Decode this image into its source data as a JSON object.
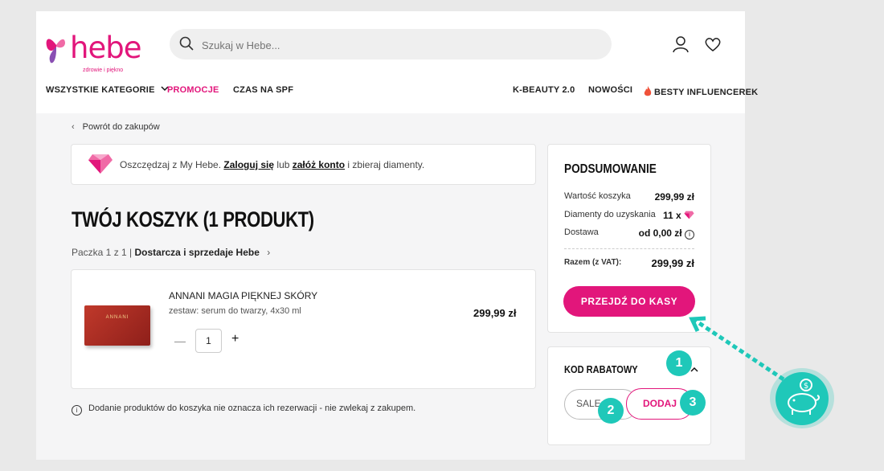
{
  "header": {
    "logo_text": "hebe",
    "logo_tagline": "zdrowie i piękno",
    "search_placeholder": "Szukaj w Hebe...",
    "nav": [
      {
        "label": "WSZYSTKIE KATEGORIE"
      },
      {
        "label": "PROMOCJE"
      },
      {
        "label": "CZAS NA SPF"
      },
      {
        "label": "K-BEAUTY 2.0"
      },
      {
        "label": "NOWOŚCI"
      },
      {
        "label": "BESTY INFLUENCEREK"
      }
    ]
  },
  "back_link": "Powrót do zakupów",
  "promo": {
    "text_before": "Oszczędzaj z My Hebe. ",
    "login": "Zaloguj się",
    "middle": " lub ",
    "register": "załóż konto",
    "text_after": " i zbieraj diamenty."
  },
  "cart": {
    "title": "TWÓJ KOSZYK (1 PRODUKT)",
    "parcel_label": "Paczka 1 z 1",
    "parcel_seller": "Dostarcza i sprzedaje Hebe",
    "product": {
      "name": "ANNANI MAGIA PIĘKNEJ SKÓRY",
      "image_text": "ANNANI",
      "description": "zestaw: serum do twarzy, 4x30 ml",
      "price": "299,99 zł",
      "quantity": "1"
    },
    "note": "Dodanie produktów do koszyka nie oznacza ich rezerwacji - nie zwlekaj z zakupem."
  },
  "summary": {
    "title": "PODSUMOWANIE",
    "rows": [
      {
        "label": "Wartość koszyka",
        "value": "299,99 zł"
      },
      {
        "label": "Diamenty do uzyskania",
        "value": "11 x"
      },
      {
        "label": "Dostawa",
        "value": "od 0,00 zł"
      }
    ],
    "total_label": "Razem (z VAT):",
    "total_value": "299,99 zł",
    "checkout_label": "PRZEJDŹ DO KASY"
  },
  "discount": {
    "title": "KOD RABATOWY",
    "input_value": "SALE",
    "apply_label": "DODAJ"
  },
  "steps": [
    "1",
    "2",
    "3"
  ],
  "colors": {
    "brand": "#e2167b",
    "annotation": "#1fc8b9"
  },
  "icons": [
    "search-icon",
    "user-icon",
    "heart-icon",
    "chevron-down-icon",
    "flame-icon",
    "diamond-icon",
    "info-icon",
    "piggy-bank-icon",
    "arrow-icon"
  ]
}
